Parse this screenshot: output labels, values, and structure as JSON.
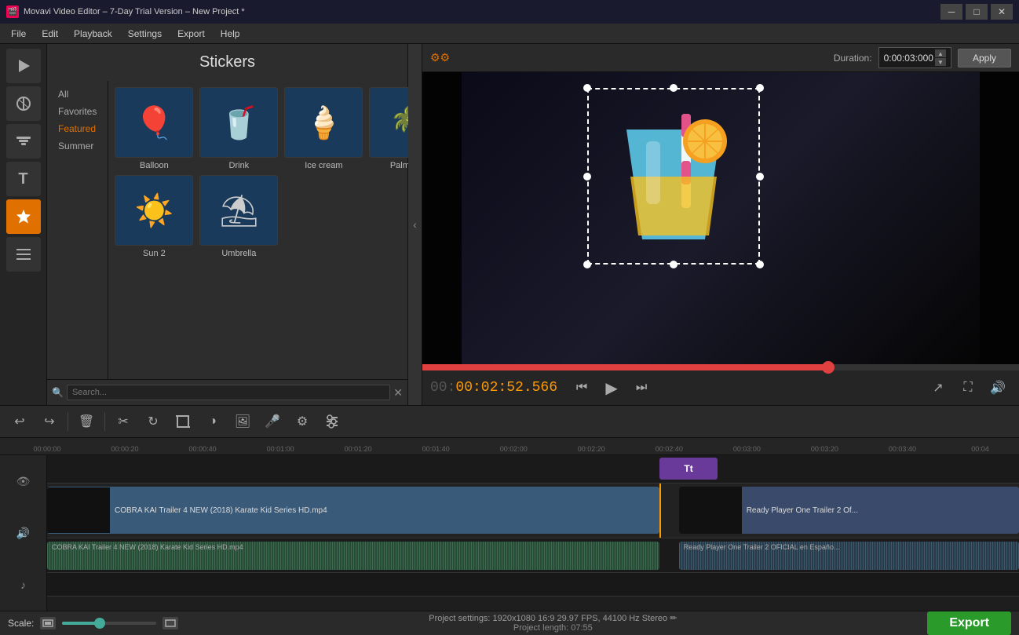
{
  "window": {
    "title": "Movavi Video Editor – 7-Day Trial Version – New Project *",
    "icon": "🎬"
  },
  "titlebar": {
    "controls": [
      "─",
      "□",
      "✕"
    ]
  },
  "menubar": {
    "items": [
      "File",
      "Edit",
      "Playback",
      "Settings",
      "Export",
      "Help"
    ]
  },
  "left_toolbar": {
    "tools": [
      {
        "name": "media-tool",
        "icon": "▶",
        "label": "Media"
      },
      {
        "name": "effects-tool",
        "icon": "✦",
        "label": "Effects"
      },
      {
        "name": "filters-tool",
        "icon": "🎞",
        "label": "Filters"
      },
      {
        "name": "text-tool",
        "icon": "T",
        "label": "Text"
      },
      {
        "name": "stickers-tool",
        "icon": "★",
        "label": "Stickers"
      },
      {
        "name": "transitions-tool",
        "icon": "≡",
        "label": "Transitions"
      }
    ]
  },
  "stickers_panel": {
    "title": "Stickers",
    "categories": [
      {
        "id": "all",
        "label": "All",
        "active": false
      },
      {
        "id": "favorites",
        "label": "Favorites",
        "active": false
      },
      {
        "id": "featured",
        "label": "Featured",
        "active": true
      },
      {
        "id": "summer",
        "label": "Summer",
        "active": false
      }
    ],
    "stickers": [
      {
        "name": "Balloon",
        "emoji": "🎈"
      },
      {
        "name": "Drink",
        "emoji": "🥤"
      },
      {
        "name": "Ice cream",
        "emoji": "🍦"
      },
      {
        "name": "Palm tree",
        "emoji": "🌴"
      },
      {
        "name": "Sun 2",
        "emoji": "☀"
      },
      {
        "name": "Umbrella",
        "emoji": "⛱"
      }
    ],
    "search_placeholder": "Search..."
  },
  "preview": {
    "duration_label": "Duration:",
    "duration_value": "0:00:03:000",
    "apply_label": "Apply",
    "time_current": "00:02:52.566",
    "settings_icon": "⚙",
    "playback_position_pct": 68
  },
  "edit_toolbar": {
    "buttons": [
      {
        "name": "undo",
        "icon": "↩",
        "label": "Undo"
      },
      {
        "name": "redo",
        "icon": "↪",
        "label": "Redo"
      },
      {
        "name": "delete",
        "icon": "🗑",
        "label": "Delete"
      },
      {
        "name": "cut",
        "icon": "✂",
        "label": "Cut"
      },
      {
        "name": "rotate",
        "icon": "↻",
        "label": "Rotate"
      },
      {
        "name": "crop",
        "icon": "⊡",
        "label": "Crop"
      },
      {
        "name": "color",
        "icon": "◑",
        "label": "Color"
      },
      {
        "name": "image",
        "icon": "🖼",
        "label": "Image"
      },
      {
        "name": "audio",
        "icon": "🎤",
        "label": "Audio"
      },
      {
        "name": "settings2",
        "icon": "⚙",
        "label": "Settings"
      },
      {
        "name": "levels",
        "icon": "⊟",
        "label": "Levels"
      }
    ]
  },
  "timeline": {
    "ruler_marks": [
      "00:00:00",
      "00:00:20",
      "00:00:40",
      "00:01:00",
      "00:01:20",
      "00:01:40",
      "00:02:00",
      "00:02:20",
      "00:02:40",
      "00:03:00",
      "00:03:20",
      "00:03:40",
      "00:04"
    ],
    "playhead_pct": 62,
    "clips": [
      {
        "label": "COBRA KAI Trailer 4 NEW (2018) Karate Kid Series HD.mp4",
        "audio_label": "COBRA KAI Trailer 4 NEW (2018) Karate Kid Series HD.mp4"
      },
      {
        "label": "Ready Player One  Trailer 2 Of...",
        "audio_label": "Ready Player One  Trailer 2 OFICIAL en Españo..."
      }
    ]
  },
  "bottom_bar": {
    "scale_label": "Scale:",
    "project_settings": "Project settings:  1920x1080  16:9  29.97 FPS, 44100 Hz Stereo  ✏",
    "project_length_label": "Project length:",
    "project_length": "07:55",
    "export_label": "Export"
  }
}
